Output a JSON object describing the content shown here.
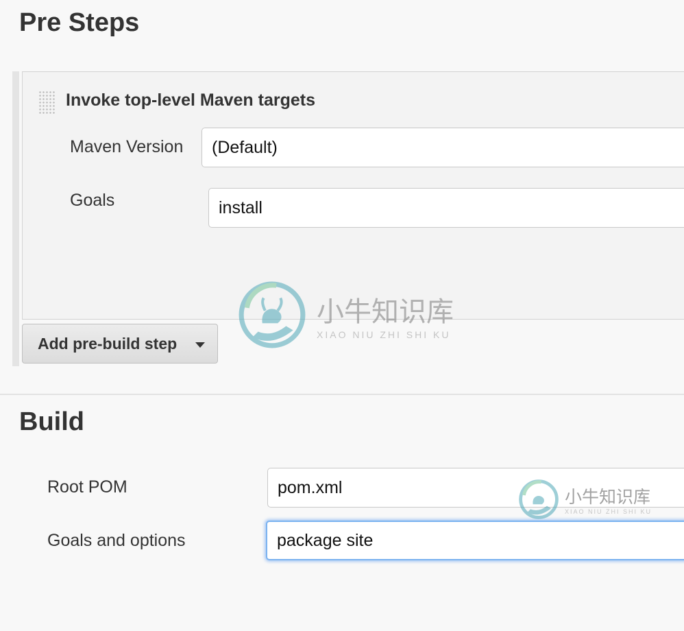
{
  "pre_steps": {
    "title": "Pre Steps",
    "step": {
      "title": "Invoke top-level Maven targets",
      "maven_version_label": "Maven Version",
      "maven_version_value": "(Default)",
      "goals_label": "Goals",
      "goals_value": "install"
    },
    "add_button_label": "Add pre-build step"
  },
  "build": {
    "title": "Build",
    "root_pom_label": "Root POM",
    "root_pom_value": "pom.xml",
    "goals_options_label": "Goals and options",
    "goals_options_value": "package site"
  },
  "watermark": {
    "cn": "小牛知识库",
    "en": "XIAO NIU ZHI SHI KU"
  },
  "colors": {
    "focus_ring": "#7ab2f0",
    "watermark_teal": "#4fa8b8",
    "watermark_green": "#74c49a"
  }
}
